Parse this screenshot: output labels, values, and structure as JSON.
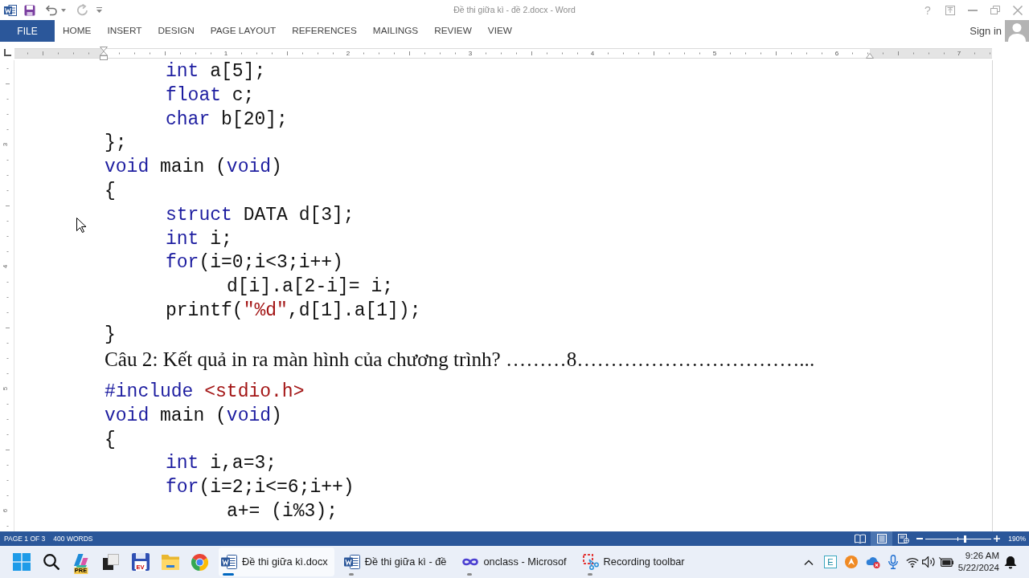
{
  "title_bar": {
    "title": "Đề thi giữa kì - đề 2.docx - Word",
    "help": "?"
  },
  "ribbon": {
    "file_tab": "FILE",
    "tabs": [
      "HOME",
      "INSERT",
      "DESIGN",
      "PAGE LAYOUT",
      "REFERENCES",
      "MAILINGS",
      "REVIEW",
      "VIEW"
    ],
    "sign_in": "Sign in"
  },
  "ruler": {
    "numbers": [
      "1",
      "2",
      "3",
      "4",
      "5",
      "6",
      "7"
    ]
  },
  "vertical_ruler": {
    "numbers": [
      "3",
      "4",
      "5",
      "6"
    ]
  },
  "document": {
    "blocks": [
      {
        "kind": "code",
        "lines": [
          {
            "segments": [
              {
                "kind": "keyword",
                "text": "\tint"
              },
              {
                "kind": "plain",
                "text": " a[5];"
              }
            ]
          },
          {
            "segments": [
              {
                "kind": "keyword",
                "text": "\tfloat"
              },
              {
                "kind": "plain",
                "text": " c;"
              }
            ]
          },
          {
            "segments": [
              {
                "kind": "keyword",
                "text": "\tchar"
              },
              {
                "kind": "plain",
                "text": " b[20];"
              }
            ]
          },
          {
            "segments": [
              {
                "kind": "plain",
                "text": "};"
              }
            ]
          },
          {
            "segments": [
              {
                "kind": "keyword",
                "text": "void"
              },
              {
                "kind": "plain",
                "text": " main ("
              },
              {
                "kind": "keyword",
                "text": "void"
              },
              {
                "kind": "plain",
                "text": ")"
              }
            ]
          },
          {
            "segments": [
              {
                "kind": "plain",
                "text": "{"
              }
            ]
          },
          {
            "segments": [
              {
                "kind": "keyword",
                "text": "\tstruct"
              },
              {
                "kind": "plain",
                "text": " DATA d[3];"
              }
            ]
          },
          {
            "segments": [
              {
                "kind": "keyword",
                "text": "\tint"
              },
              {
                "kind": "plain",
                "text": " i;"
              }
            ]
          },
          {
            "segments": [
              {
                "kind": "keyword",
                "text": "\tfor"
              },
              {
                "kind": "plain",
                "text": "(i=0;i<3;i++)"
              }
            ]
          },
          {
            "segments": [
              {
                "kind": "plain",
                "text": "\t\td[i].a[2-i]= i;"
              }
            ]
          },
          {
            "segments": [
              {
                "kind": "plain",
                "text": "\tprintf("
              },
              {
                "kind": "string",
                "text": "\"%d\""
              },
              {
                "kind": "plain",
                "text": ",d[1].a[1]);"
              }
            ]
          },
          {
            "segments": [
              {
                "kind": "plain",
                "text": "}"
              }
            ]
          }
        ]
      },
      {
        "kind": "paragraph",
        "text": "Câu 2: Kết quả in ra màn hình của chương trình? ………8……………………………..."
      },
      {
        "kind": "code",
        "lines": [
          {
            "segments": [
              {
                "kind": "keyword",
                "text": "#include"
              },
              {
                "kind": "string",
                "text": " <stdio.h>"
              }
            ]
          },
          {
            "segments": [
              {
                "kind": "keyword",
                "text": "void"
              },
              {
                "kind": "plain",
                "text": " main ("
              },
              {
                "kind": "keyword",
                "text": "void"
              },
              {
                "kind": "plain",
                "text": ")"
              }
            ]
          },
          {
            "segments": [
              {
                "kind": "plain",
                "text": "{"
              }
            ]
          },
          {
            "segments": [
              {
                "kind": "keyword",
                "text": "\tint"
              },
              {
                "kind": "plain",
                "text": " i,a=3;"
              }
            ]
          },
          {
            "segments": [
              {
                "kind": "keyword",
                "text": "\tfor"
              },
              {
                "kind": "plain",
                "text": "(i=2;i<=6;i++)"
              }
            ]
          },
          {
            "segments": [
              {
                "kind": "plain",
                "text": "\t\ta+= (i%3);"
              }
            ]
          }
        ]
      }
    ]
  },
  "status_bar": {
    "page": "PAGE 1 OF 3",
    "words": "400 WORDS",
    "views": [
      {
        "kind": "read",
        "selected": false
      },
      {
        "kind": "print",
        "selected": true
      },
      {
        "kind": "web",
        "selected": false
      }
    ],
    "zoom": {
      "level": 0.6,
      "label": "190%"
    }
  },
  "taskbar": {
    "pinned": [
      {
        "kind": "start"
      },
      {
        "kind": "search"
      },
      {
        "kind": "copilot",
        "badge": "PRE"
      },
      {
        "kind": "task_view"
      },
      {
        "kind": "floppy",
        "badge": "EV"
      },
      {
        "kind": "explorer"
      },
      {
        "kind": "chrome"
      }
    ],
    "windows": [
      {
        "kind": "word",
        "label": "Đề thi giữa kì.docx",
        "selected": true
      },
      {
        "kind": "word",
        "label": "Đề thi giữa kì - đề",
        "selected": false
      },
      {
        "kind": "onclass",
        "label": "onclass - Microsof",
        "selected": false
      },
      {
        "kind": "snip",
        "label": "Recording toolbar",
        "selected": false
      }
    ],
    "tray": [
      {
        "kind": "chevron"
      },
      {
        "kind": "ime",
        "label": "E"
      },
      {
        "kind": "orange"
      },
      {
        "kind": "cloud"
      },
      {
        "kind": "mic"
      },
      {
        "kind": "wifi"
      },
      {
        "kind": "speaker"
      },
      {
        "kind": "battery"
      }
    ],
    "clock": {
      "time": "9:26 AM",
      "date": "5/22/2024"
    }
  }
}
